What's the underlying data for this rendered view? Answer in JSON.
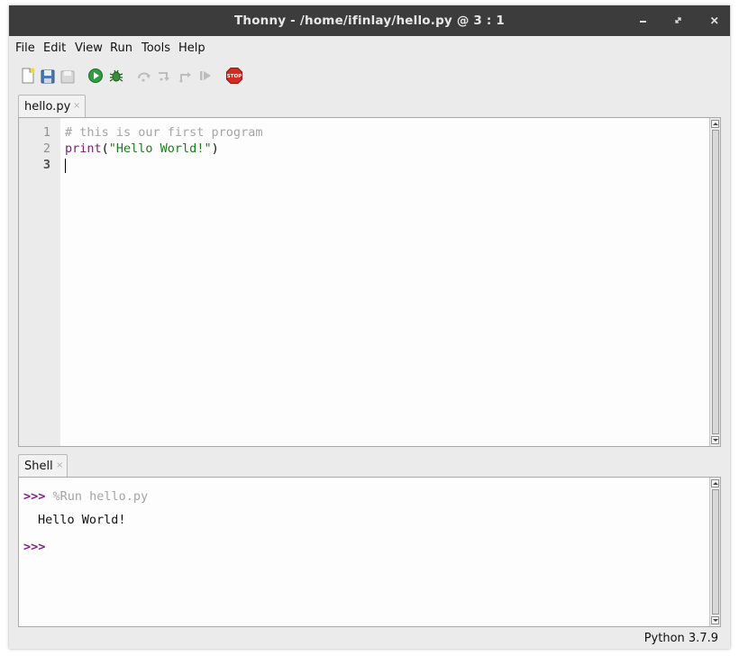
{
  "window": {
    "title": "Thonny  -  /home/ifinlay/hello.py  @  3 : 1",
    "controls": [
      "minimize",
      "maximize",
      "close"
    ]
  },
  "menu": {
    "items": [
      "File",
      "Edit",
      "View",
      "Run",
      "Tools",
      "Help"
    ]
  },
  "toolbar": {
    "buttons": [
      "new-file-icon",
      "open-file-icon",
      "save-file-icon",
      "run-icon",
      "debug-icon",
      "step-over-icon",
      "step-into-icon",
      "step-out-icon",
      "resume-icon",
      "stop-icon"
    ],
    "stop_label": "STOP"
  },
  "editor": {
    "tab": {
      "label": "hello.py",
      "close": "×"
    },
    "line_numbers": [
      "1",
      "2",
      "3"
    ],
    "lines": [
      {
        "comment": "# this is our first program"
      },
      {
        "builtin": "print",
        "open": "(",
        "string": "\"Hello World!\"",
        "close": ")"
      },
      {
        "text": ""
      }
    ],
    "cursor": "3 : 1"
  },
  "shell": {
    "tab": {
      "label": "Shell",
      "close": "×"
    },
    "prompt": ">>>",
    "command": "%Run hello.py",
    "output": "Hello World!",
    "prompt2": ">>>"
  },
  "status": {
    "interpreter": "Python 3.7.9"
  },
  "colors": {
    "titlebar": "#3c3c3c",
    "chrome": "#ebebeb",
    "editor_bg": "#fdfdfd",
    "comment": "#a5a5a5",
    "builtin": "#7a1f6e",
    "string": "#1e7a1e",
    "prompt": "#8b1a8b",
    "run": "#2e9e3e",
    "stop": "#d32b1f"
  }
}
